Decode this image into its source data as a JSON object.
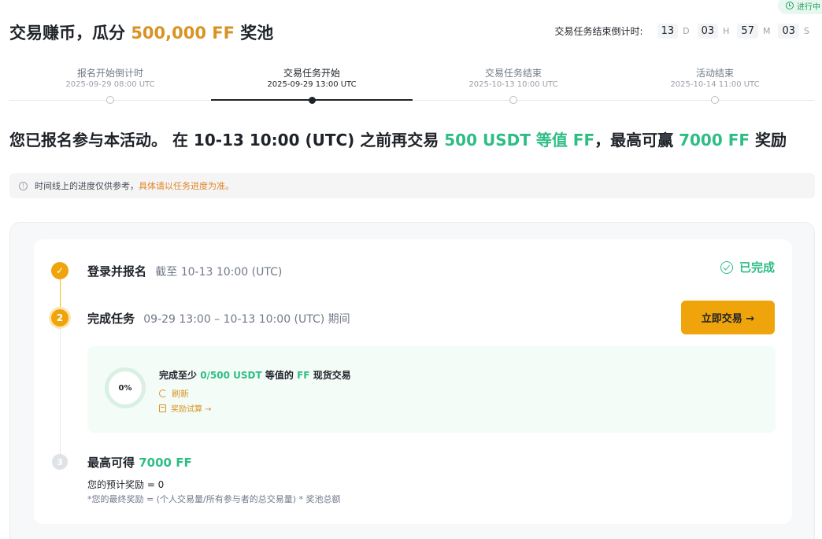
{
  "status_badge": "进行中",
  "header": {
    "title_prefix": "交易赚币，瓜分",
    "title_amount": "500,000 FF",
    "title_suffix": "奖池"
  },
  "countdown": {
    "label": "交易任务结束倒计时:",
    "days": "13",
    "days_unit": "D",
    "hours": "03",
    "hours_unit": "H",
    "minutes": "57",
    "minutes_unit": "M",
    "seconds": "03",
    "seconds_unit": "S"
  },
  "timeline": [
    {
      "label": "报名开始倒计时",
      "date": "2025-09-29 08:00 UTC"
    },
    {
      "label": "交易任务开始",
      "date": "2025-09-29 13:00 UTC"
    },
    {
      "label": "交易任务结束",
      "date": "2025-10-13 10:00 UTC"
    },
    {
      "label": "活动结束",
      "date": "2025-10-14 11:00 UTC"
    }
  ],
  "headline": {
    "part1": "您已报名参与本活动。 在 10-13 10:00 (UTC) 之前再交易",
    "amount": "500 USDT 等值 FF",
    "part2": "，最高可赢",
    "reward": "7000 FF",
    "part3": "奖励"
  },
  "notice": {
    "text": "时间线上的进度仅供参考，",
    "link": "具体请以任务进度为准。"
  },
  "steps": {
    "step1": {
      "badge": "✓",
      "title": "登录并报名",
      "subtitle": "截至 10-13 10:00 (UTC)",
      "status": "已完成"
    },
    "step2": {
      "badge": "2",
      "title": "完成任务",
      "subtitle": "09-29 13:00 – 10-13 10:00 (UTC) 期间",
      "button": "立即交易 →",
      "progress": "0%",
      "task_prefix": "完成至少",
      "task_amount": "0/500 USDT",
      "task_mid": "等值的",
      "task_token": "FF",
      "task_suffix": "现货交易",
      "refresh": "刷新",
      "calc": "奖励试算 →"
    },
    "step3": {
      "badge": "3",
      "title_prefix": "最高可得",
      "title_amount": "7000 FF",
      "estimate": "您的预计奖励 = 0",
      "formula": "*您的最终奖励 = (个人交易量/所有参与者的总交易量) * 奖池总额"
    }
  },
  "colors": {
    "accent": "#f0a40b",
    "gold_text": "#d89323",
    "green": "#2ebd85"
  }
}
